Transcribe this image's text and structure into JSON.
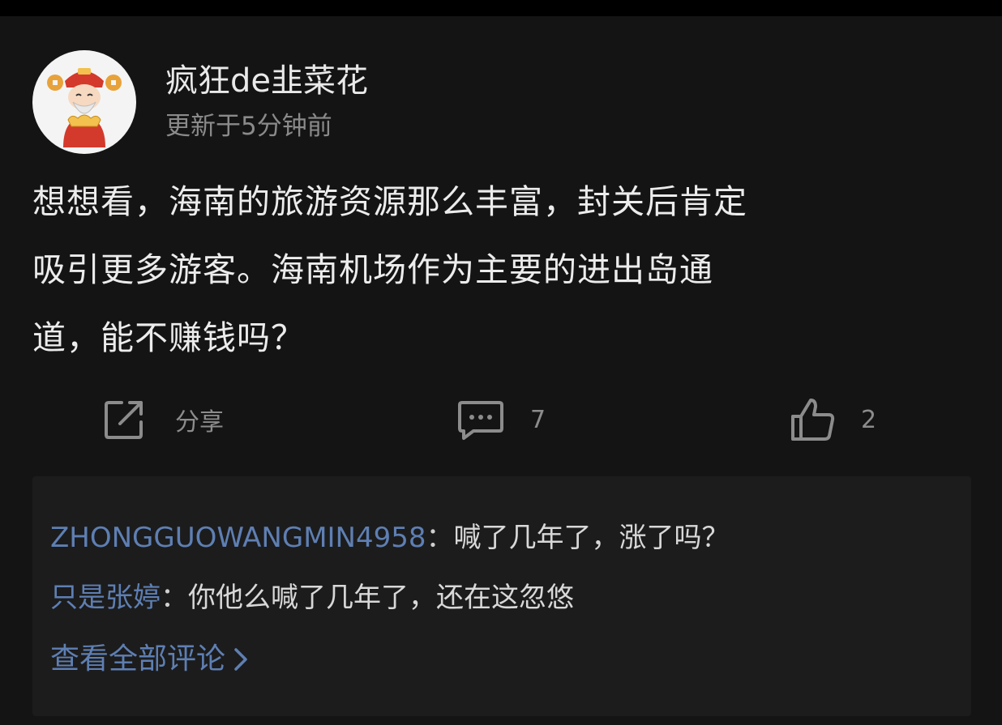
{
  "post": {
    "author": "疯狂de韭菜花",
    "time": "更新于5分钟前",
    "content_lines": [
      "想想看，海南的旅游资源那么丰富，封关后肯定",
      "吸引更多游客。海南机场作为主要的进出岛通",
      "道，能不赚钱吗？"
    ],
    "avatar_icon": "caishen-avatar-icon"
  },
  "actions": {
    "share_label": "分享",
    "comment_count": "7",
    "like_count": "2",
    "share_icon": "share-icon",
    "comment_icon": "comment-icon",
    "like_icon": "thumbs-up-icon"
  },
  "comments": [
    {
      "author": "ZHONGGUOWANGMIN4958",
      "sep": "：",
      "text": "喊了几年了，涨了吗？"
    },
    {
      "author": "只是张婷",
      "sep": "：",
      "text": "你他么喊了几年了，还在这忽悠"
    }
  ],
  "view_all": "查看全部评论",
  "colors": {
    "background": "#141414",
    "comments_bg": "#1c1c1c",
    "link_blue": "#5e7fb3",
    "muted": "#8c8c8c"
  }
}
